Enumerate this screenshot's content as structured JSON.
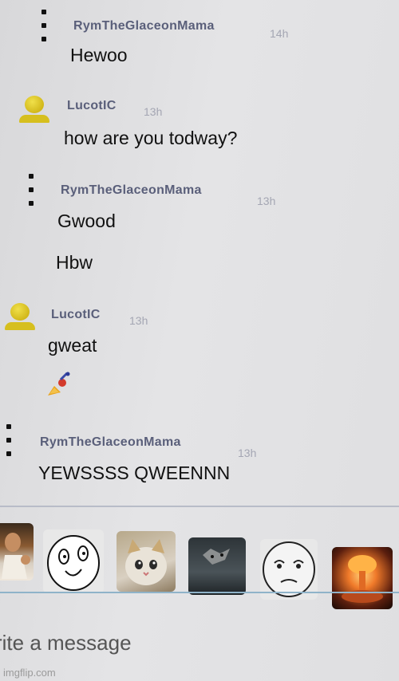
{
  "messages": [
    {
      "user": "RymTheGlaceonMama",
      "time": "14h",
      "avatar": "kebab-menu-icon",
      "lines": [
        "Hewoo"
      ]
    },
    {
      "user": "LucotIC",
      "time": "13h",
      "avatar": "user-avatar-icon",
      "lines": [
        "how are you todway?"
      ]
    },
    {
      "user": "RymTheGlaceonMama",
      "time": "13h",
      "avatar": "kebab-menu-icon",
      "lines": [
        "Gwood",
        "Hbw"
      ]
    },
    {
      "user": "LucotIC",
      "time": "13h",
      "avatar": "user-avatar-icon",
      "lines": [
        "gweat"
      ],
      "extra_icon": "gift-sparkle-icon"
    },
    {
      "user": "RymTheGlaceonMama",
      "time": "13h",
      "avatar": "kebab-menu-icon",
      "lines": [
        "YEWSSSS QWEENNN"
      ]
    }
  ],
  "emoji_tray": [
    {
      "name": "emoji-jesus-thumbs-up"
    },
    {
      "name": "emoji-awesome-face"
    },
    {
      "name": "emoji-crying-cat"
    },
    {
      "name": "emoji-cat-peek"
    },
    {
      "name": "emoji-okay-face"
    },
    {
      "name": "emoji-nuke-explosion"
    }
  ],
  "composer": {
    "placeholder": "rite a message"
  },
  "watermark": "imgflip.com",
  "colors": {
    "username": "#5a5f7a",
    "timestamp": "#a4a6b3",
    "avatar_yellow": "#d6bf1e"
  }
}
